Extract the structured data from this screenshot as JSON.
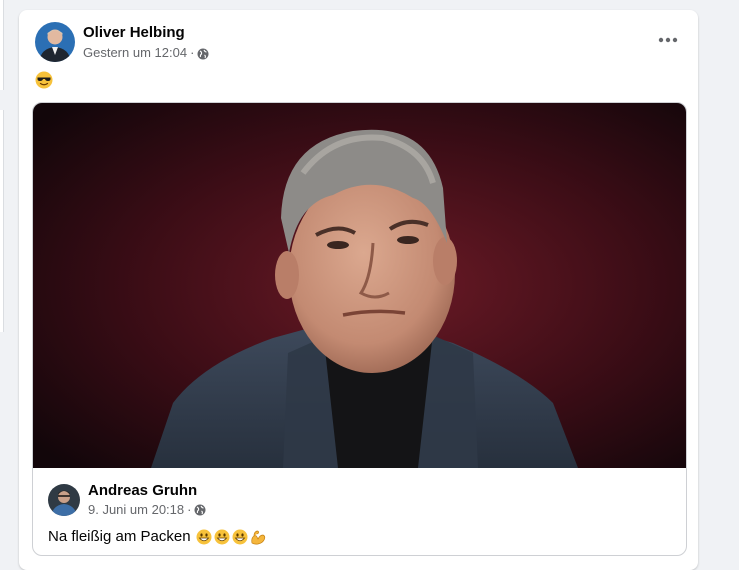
{
  "post": {
    "author": "Oliver Helbing",
    "timestamp": "Gestern um 12:04",
    "separator": "·",
    "privacy_icon": "globe-icon",
    "more_icon": "more-options-icon",
    "text_emoji": "sunglasses-face-emoji"
  },
  "shared_post": {
    "author": "Andreas Gruhn",
    "timestamp": "9. Juni um 20:18",
    "separator": "·",
    "privacy_icon": "globe-icon",
    "text": "Na fleißig am Packen",
    "emojis": [
      "grinning-face-emoji",
      "grinning-face-emoji",
      "grinning-face-emoji",
      "flexed-biceps-emoji"
    ]
  },
  "colors": {
    "background": "#f0f2f5",
    "card": "#ffffff",
    "primary_text": "#050505",
    "secondary_text": "#65676b",
    "photo_backdrop": "#5a1420"
  }
}
